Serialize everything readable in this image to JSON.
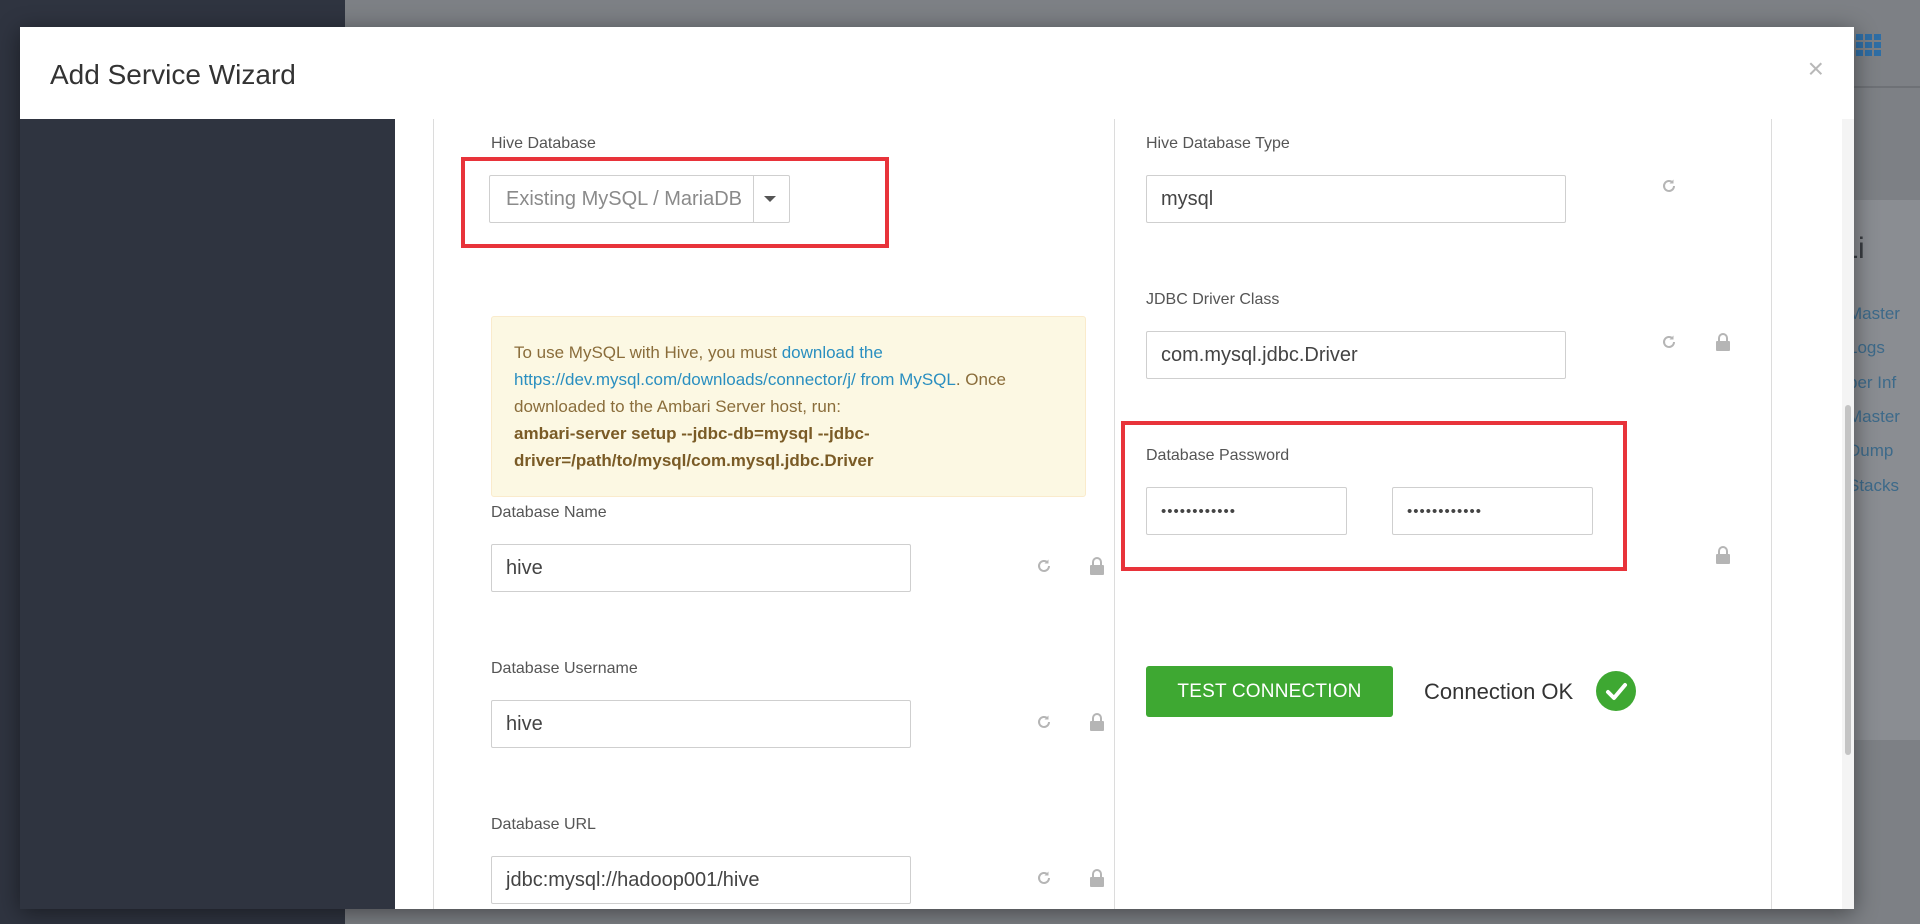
{
  "background": {
    "quick_links_title": "k Li",
    "quick_links": [
      "Master",
      "Logs",
      "per Inf",
      "Master",
      "Dump",
      "Stacks"
    ]
  },
  "modal": {
    "title": "Add Service Wizard",
    "close_label": "×"
  },
  "form": {
    "hive_database": {
      "label": "Hive Database",
      "selected": "Existing MySQL / MariaDB"
    },
    "info": {
      "text_1": "To use MySQL with Hive, you must ",
      "link_1": "download the https://dev.mysql.com/downloads/connector/j/ from MySQL",
      "text_2": ". Once downloaded to the Ambari Server host, run:",
      "command": "ambari-server setup --jdbc-db=mysql --jdbc-driver=/path/to/mysql/com.mysql.jdbc.Driver"
    },
    "database_name": {
      "label": "Database Name",
      "value": "hive"
    },
    "database_username": {
      "label": "Database Username",
      "value": "hive"
    },
    "database_url": {
      "label": "Database URL",
      "value": "jdbc:mysql://hadoop001/hive"
    },
    "hive_database_type": {
      "label": "Hive Database Type",
      "value": "mysql"
    },
    "jdbc_driver_class": {
      "label": "JDBC Driver Class",
      "value": "com.mysql.jdbc.Driver"
    },
    "database_password": {
      "label": "Database Password",
      "value": "••••••••••••",
      "confirm_value": "••••••••••••"
    },
    "test_connection": {
      "button_label": "TEST CONNECTION",
      "status": "Connection OK"
    }
  },
  "colors": {
    "accent_green": "#3ea832",
    "highlight_red": "#e8333a",
    "sidebar_dark": "#2f3440",
    "link_blue": "#2a8fc0"
  },
  "icons": {
    "refresh": "refresh-icon",
    "lock": "lock-icon",
    "close": "close-icon",
    "check": "check-circle-icon",
    "caret": "caret-down-icon",
    "apps": "app-grid-icon"
  }
}
